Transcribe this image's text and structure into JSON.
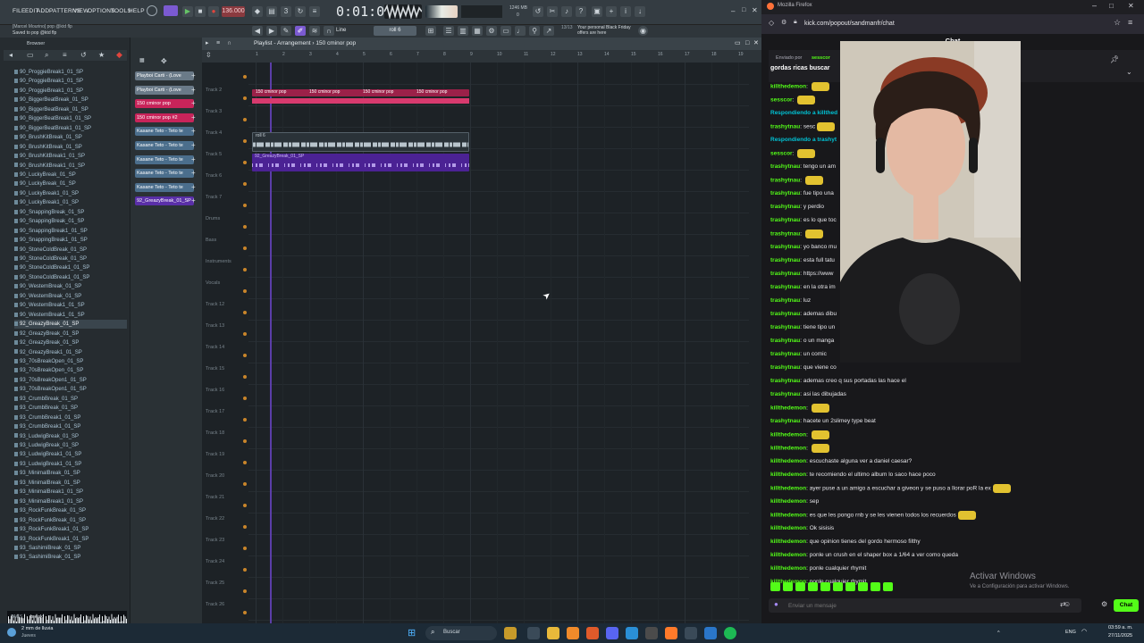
{
  "fl": {
    "menu": [
      "FILE",
      "EDIT",
      "ADD",
      "PATTERNS",
      "VIEW",
      "OPTIONS",
      "TOOLS",
      "HELP"
    ],
    "tempo": "136.000",
    "time": "0:01:07",
    "pattern": "roll 6",
    "snap": "Line",
    "hint_title": "[Marcel Mourino] pop @ktd flp",
    "hint_sub": "Saved to pop @ktd flp",
    "news": "Your personal Black Friday offers are here",
    "news_count": "13/13",
    "cpu": "1246 MB",
    "cpu2": "0",
    "browser_title": "Browser",
    "playlist_title": "Playlist - Arrangement › 150 cminor pop",
    "browser_files": [
      "90_ProggieBreak1_01_SP",
      "90_ProggieBreak1_01_SP",
      "90_ProggieBreak1_01_SP",
      "90_BiggerBeatBreak_01_SP",
      "90_BiggerBeatBreak_01_SP",
      "90_BiggerBeatBreak1_01_SP",
      "90_BiggerBeatBreak1_01_SP",
      "90_BrushKitBreak_01_SP",
      "90_BrushKitBreak_01_SP",
      "90_BrushKitBreak1_01_SP",
      "90_BrushKitBreak1_01_SP",
      "90_LuckyBreak_01_SP",
      "90_LuckyBreak_01_SP",
      "90_LuckyBreak1_01_SP",
      "90_LuckyBreak1_01_SP",
      "90_SnappingBreak_01_SP",
      "90_SnappingBreak_01_SP",
      "90_SnappingBreak1_01_SP",
      "90_SnappingBreak1_01_SP",
      "90_StoneColdBreak_01_SP",
      "90_StoneColdBreak_01_SP",
      "90_StoneColdBreak1_01_SP",
      "90_StoneColdBreak1_01_SP",
      "90_WesternBreak_01_SP",
      "90_WesternBreak_01_SP",
      "90_WesternBreak1_01_SP",
      "90_WesternBreak1_01_SP",
      "92_GreazyBreak_01_SP",
      "92_GreazyBreak_01_SP",
      "92_GreazyBreak_01_SP",
      "92_GreazyBreak1_01_SP",
      "93_70sBreakOpen_01_SP",
      "93_70sBreakOpen_01_SP",
      "93_70sBreakOpen1_01_SP",
      "93_70sBreakOpen1_01_SP",
      "93_CrumbBreak_01_SP",
      "93_CrumbBreak_01_SP",
      "93_CrumbBreak1_01_SP",
      "93_CrumbBreak1_01_SP",
      "93_LudwigBreak_01_SP",
      "93_LudwigBreak_01_SP",
      "93_LudwigBreak1_01_SP",
      "93_LudwigBreak1_01_SP",
      "93_MinimalBreak_01_SP",
      "93_MinimalBreak_01_SP",
      "93_MinimalBreak1_01_SP",
      "93_MinimalBreak1_01_SP",
      "93_RockFunkBreak_01_SP",
      "93_RockFunkBreak_01_SP",
      "93_RockFunkBreak1_01_SP",
      "93_RockFunkBreak1_01_SP",
      "93_SashimiBreak_01_SP",
      "93_SashimiBreak_01_SP"
    ],
    "selected_file_index": 27,
    "wave_info": "44.1 kHz 16 bit 1.22 s",
    "tags_label": "TAGS",
    "tags_value": "break",
    "channels": [
      {
        "name": "Playboi Carti - (Love",
        "color": "#6a7a88"
      },
      {
        "name": "Playboi Carti - (Love",
        "color": "#6a7a88"
      },
      {
        "name": "150 cminor pop",
        "color": "#c8245a"
      },
      {
        "name": "150 cminor pop #2",
        "color": "#c8245a"
      },
      {
        "name": "Kasane Teto - Teto te",
        "color": "#4b6e8c"
      },
      {
        "name": "Kasane Teto - Teto te",
        "color": "#4b6e8c"
      },
      {
        "name": "Kasane Teto - Teto te",
        "color": "#4b6e8c"
      },
      {
        "name": "Kasane Teto - Teto te",
        "color": "#4b6e8c"
      },
      {
        "name": "Kasane Teto - Teto te",
        "color": "#4b6e8c"
      },
      {
        "name": "92_GreazyBreak_01_SP",
        "color": "#5a2fa8"
      }
    ],
    "tracks": [
      "",
      "Track 2",
      "Track 3",
      "Track 4",
      "Track 5",
      "Track 6",
      "Track 7",
      "Drums",
      "Bass",
      "Instruments",
      "Vocals",
      "Track 12",
      "Track 13",
      "Track 14",
      "Track 15",
      "Track 16",
      "Track 17",
      "Track 18",
      "Track 19",
      "Track 20",
      "Track 21",
      "Track 22",
      "Track 23",
      "Track 24",
      "Track 25",
      "Track 26"
    ],
    "ruler": [
      "1",
      "2",
      "3",
      "4",
      "5",
      "6",
      "7",
      "8",
      "9",
      "10",
      "11",
      "12",
      "13",
      "14",
      "15",
      "16",
      "17",
      "18",
      "19"
    ],
    "clips_pink": [
      "150 cminor pop",
      "150 cminor pop",
      "150 cminor pop",
      "150 cminor pop"
    ],
    "clip_teto": "roll 6",
    "clip_purple": "92_GreazyBreak_01_SP"
  },
  "firefox": {
    "window_title": "Mozilla Firefox",
    "url": "kick.com/popout/sandmanfr/chat",
    "chat_title": "Chat",
    "reply_label": "Enviado por",
    "reply_user": "sesscor",
    "pinned": "gordas ricas buscar",
    "input_placeholder": "Enviar un mensaje",
    "chat_button": "Chat",
    "activate_title": "Activar Windows",
    "activate_sub": "Ve a Configuración para activar Windows.",
    "messages": [
      {
        "user": "killthedemon",
        "text": "",
        "emote": true,
        "alt": false
      },
      {
        "user": "sesscor",
        "text": "",
        "emote": true,
        "alt": false
      },
      {
        "user": "Respondiendo a killthed",
        "text": "",
        "emote": false,
        "alt": true
      },
      {
        "user": "trashytnau",
        "text": "sesc",
        "emote": true,
        "alt": false
      },
      {
        "user": "Respondiendo a trashyt",
        "text": "",
        "emote": false,
        "alt": true
      },
      {
        "user": "sesscor",
        "text": "",
        "emote": true,
        "alt": false
      },
      {
        "user": "trashytnau",
        "text": "tengo un am",
        "emote": false,
        "alt": false
      },
      {
        "user": "trashytnau",
        "text": "",
        "emote": true,
        "alt": false
      },
      {
        "user": "trashytnau",
        "text": "fue tipo una",
        "emote": false,
        "alt": false
      },
      {
        "user": "trashytnau",
        "text": "y perdio",
        "emote": false,
        "alt": false
      },
      {
        "user": "trashytnau",
        "text": "es lo que toc",
        "emote": false,
        "alt": false
      },
      {
        "user": "trashytnau",
        "text": "",
        "emote": true,
        "alt": false
      },
      {
        "user": "trashytnau",
        "text": "yo banco mu",
        "emote": false,
        "alt": false
      },
      {
        "user": "trashytnau",
        "text": "esta full tatu",
        "emote": false,
        "alt": false
      },
      {
        "user": "trashytnau",
        "text": "https://www",
        "emote": false,
        "alt": false
      },
      {
        "user": "trashytnau",
        "text": "en la otra im",
        "emote": false,
        "alt": false
      },
      {
        "user": "trashytnau",
        "text": "luz",
        "emote": false,
        "alt": false
      },
      {
        "user": "trashytnau",
        "text": "ademas dibu",
        "emote": false,
        "alt": false
      },
      {
        "user": "trashytnau",
        "text": "tiene tipo un",
        "emote": false,
        "alt": false
      },
      {
        "user": "trashytnau",
        "text": "o un manga",
        "emote": false,
        "alt": false
      },
      {
        "user": "trashytnau",
        "text": "un comic",
        "emote": false,
        "alt": false
      },
      {
        "user": "trashytnau",
        "text": "que viene co",
        "emote": false,
        "alt": false
      },
      {
        "user": "trashytnau",
        "text": "ademas creo q sus portadas las hace el",
        "emote": false,
        "alt": false
      },
      {
        "user": "trashytnau",
        "text": "asi las dibujadas",
        "emote": false,
        "alt": false
      },
      {
        "user": "killthedemon",
        "text": "",
        "emote": true,
        "alt": false
      },
      {
        "user": "trashytnau",
        "text": "hacete un 2slimey type beat",
        "emote": false,
        "alt": false
      },
      {
        "user": "killthedemon",
        "text": "",
        "emote": true,
        "alt": false
      },
      {
        "user": "killthedemon",
        "text": "",
        "emote": true,
        "alt": false
      },
      {
        "user": "killthedemon",
        "text": "escuchaste alguna ver a daniel caesar?",
        "emote": false,
        "alt": false
      },
      {
        "user": "killthedemon",
        "text": "te recomiendo el ultimo album lo saco hace poco",
        "emote": false,
        "alt": false
      },
      {
        "user": "killthedemon",
        "text": "ayer puse a un amigo a escuchar a giveon y se puso a llorar poR la ex",
        "emote": true,
        "alt": false
      },
      {
        "user": "killthedemon",
        "text": "sep",
        "emote": false,
        "alt": false
      },
      {
        "user": "killthedemon",
        "text": "es que les pongo rnb y se les vienen todos los recuerdos",
        "emote": true,
        "alt": false
      },
      {
        "user": "killthedemon",
        "text": "Ok sisisis",
        "emote": false,
        "alt": false
      },
      {
        "user": "killthedemon",
        "text": "que opinion tienes del gordo hermoso filthy",
        "emote": false,
        "alt": false
      },
      {
        "user": "killthedemon",
        "text": "ponle un crush en el shaper box a 1/64 a ver como queda",
        "emote": false,
        "alt": false
      },
      {
        "user": "killthedemon",
        "text": "ponle cualquier rhymit",
        "emote": false,
        "alt": false
      },
      {
        "user": "killthedemon",
        "text": "ponle cualquier rhymit",
        "emote": false,
        "alt": false
      }
    ]
  },
  "taskbar": {
    "weather": "2 mm de lluvia",
    "weather_sub": "Jueves",
    "search": "Buscar",
    "lang": "ENG",
    "time": "03:59 a. m.",
    "date": "27/11/2025"
  }
}
